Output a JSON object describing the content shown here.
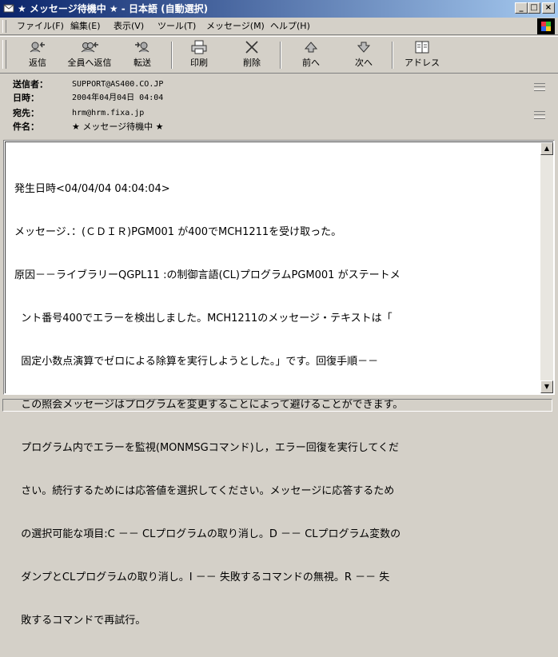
{
  "window": {
    "title": "★ メッセージ待機中 ★ - 日本語 (自動選択)",
    "controls": {
      "minimize": "_",
      "maximize": "□",
      "close": "×"
    }
  },
  "menu": {
    "items": [
      "ファイル(F)",
      "編集(E)",
      "表示(V)",
      "ツール(T)",
      "メッセージ(M)",
      "ヘルプ(H)"
    ]
  },
  "toolbar": {
    "buttons": [
      {
        "label": "返信",
        "icon": "reply-icon"
      },
      {
        "label": "全員へ返信",
        "icon": "reply-all-icon"
      },
      {
        "label": "転送",
        "icon": "forward-icon"
      },
      {
        "label": "印刷",
        "icon": "print-icon"
      },
      {
        "label": "削除",
        "icon": "delete-icon"
      },
      {
        "label": "前へ",
        "icon": "previous-icon"
      },
      {
        "label": "次へ",
        "icon": "next-icon"
      },
      {
        "label": "アドレス",
        "icon": "address-book-icon"
      }
    ]
  },
  "header": {
    "from_label": "送信者：",
    "from": "SUPPORT@AS400.CO.JP",
    "date_label": "日時：",
    "date": "2004年04月04日 04:04",
    "to_label": "宛先：",
    "to": "hrm@hrm.fixa.jp",
    "subject_label": "件名：",
    "subject": "★ メッセージ待機中 ★"
  },
  "body": {
    "lines": [
      "発生日時<04/04/04 04:04:04>",
      "メッセージ．：(ＣＤＩＲ)PGM001 が400でMCH1211を受け取った。",
      "原因－－ライブラリーQGPL11 :の制御言語(CL)プログラムPGM001 がステートメ",
      "  ント番号400でエラーを検出しました。MCH1211のメッセージ・テキストは「",
      "  固定小数点演算でゼロによる除算を実行しようとした。」です。回復手順－－",
      "  この照会メッセージはプログラムを変更することによって避けることができます。",
      "  プログラム内でエラーを監視(MONMSGコマンド)し，エラー回復を実行してくだ",
      "  さい。続行するためには応答値を選択してください。メッセージに応答するため",
      "  の選択可能な項目:C －－ CLプログラムの取り消し。D －－ CLプログラム変数の",
      "  ダンプとCLプログラムの取り消し。I －－ 失敗するコマンドの無視。R －－ 失",
      "  敗するコマンドで再試行。"
    ]
  },
  "scrollbar": {
    "up": "▲",
    "down": "▼"
  }
}
